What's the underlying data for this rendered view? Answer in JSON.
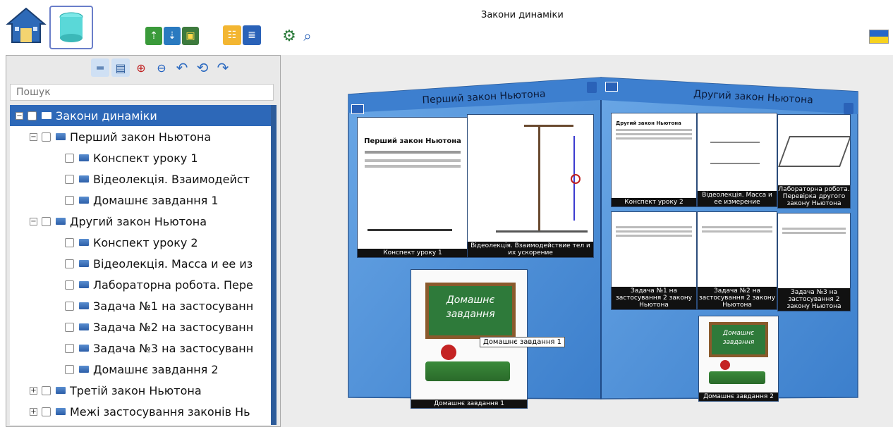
{
  "app": {
    "title": "Закони динаміки"
  },
  "toolbar": {
    "home_icon": "house-icon",
    "db_icon": "database-icon",
    "groups": [
      [
        "upload-icon",
        "download-icon",
        "folder-export-icon"
      ],
      [
        "structure-icon",
        "list-icon"
      ],
      [
        "settings-icon",
        "search-icon"
      ]
    ],
    "language_icon": "ukraine-flag-icon"
  },
  "left_toolbar": [
    "collapse-icon",
    "expand-icon",
    "zoom-in-icon",
    "zoom-out-icon",
    "back-icon",
    "refresh-icon",
    "forward-icon"
  ],
  "search": {
    "placeholder": "Пошук"
  },
  "tree": [
    {
      "label": "Закони динаміки",
      "level": 0,
      "expander": "−",
      "selected": true
    },
    {
      "label": "Перший закон Ньютона",
      "level": 1,
      "expander": "−"
    },
    {
      "label": "Конспект уроку 1",
      "level": 2
    },
    {
      "label": "Відеолекція. Взаимодейст",
      "level": 2
    },
    {
      "label": "Домашнє завдання 1",
      "level": 2
    },
    {
      "label": "Другий закон Ньютона",
      "level": 1,
      "expander": "−"
    },
    {
      "label": "Конспект уроку 2",
      "level": 2
    },
    {
      "label": "Відеолекція. Масса и ее из",
      "level": 2
    },
    {
      "label": "Лабораторна робота. Пере",
      "level": 2
    },
    {
      "label": "Задача №1 на застосуванн",
      "level": 2
    },
    {
      "label": "Задача №2 на застосуванн",
      "level": 2
    },
    {
      "label": "Задача №3 на застосуванн",
      "level": 2
    },
    {
      "label": "Домашнє завдання 2",
      "level": 2
    },
    {
      "label": "Третій закон Ньютона",
      "level": 1,
      "expander": "+"
    },
    {
      "label": "Межі застосування законів Нь",
      "level": 1,
      "expander": "+"
    }
  ],
  "cube": {
    "left": {
      "title": "Перший закон Ньютона",
      "slide_title": "Перший закон Ньютона",
      "thumbs": [
        "Конспект уроку 1",
        "Відеолекція. Взаимодействие тел и их ускорение"
      ],
      "homework_board_text": "Домашнє завдання",
      "homework_caption": "Домашнє завдання 1",
      "tooltip": "Домашнє завдання 1"
    },
    "right": {
      "title": "Другий закон Ньютона",
      "slide_title": "Другий закон Ньютона",
      "thumbs_row1": [
        "Конспект уроку 2",
        "Відеолекція. Масса и ее измерение",
        "Лабораторна робота. Перевірка другого закону Ньютона"
      ],
      "thumbs_row2": [
        "Задача №1 на застосування 2 закону Ньютона",
        "Задача №2 на застосування 2 закону Ньютона",
        "Задача №3 на застосування 2 закону Ньютона"
      ],
      "homework_board_text": "Домашнє завдання",
      "homework_caption": "Домашнє завдання 2"
    }
  },
  "colors": {
    "accent": "#2d68b8",
    "cube_blue": "#4f8fd6",
    "board_green": "#2e7a3a"
  }
}
